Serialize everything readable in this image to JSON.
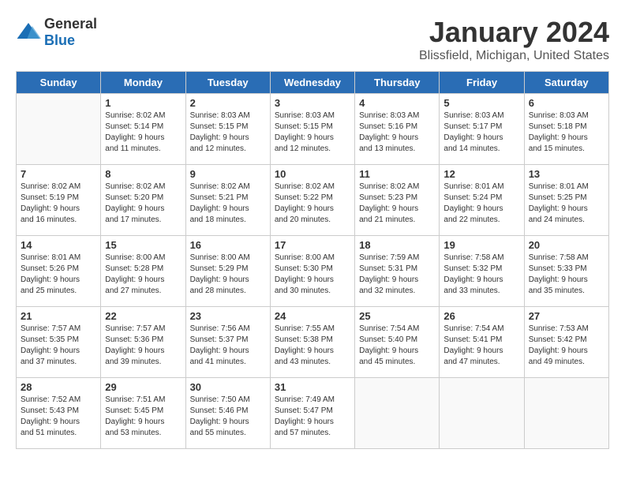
{
  "header": {
    "logo_general": "General",
    "logo_blue": "Blue",
    "month_year": "January 2024",
    "location": "Blissfield, Michigan, United States"
  },
  "weekdays": [
    "Sunday",
    "Monday",
    "Tuesday",
    "Wednesday",
    "Thursday",
    "Friday",
    "Saturday"
  ],
  "weeks": [
    [
      {
        "day": "",
        "info": ""
      },
      {
        "day": "1",
        "info": "Sunrise: 8:02 AM\nSunset: 5:14 PM\nDaylight: 9 hours\nand 11 minutes."
      },
      {
        "day": "2",
        "info": "Sunrise: 8:03 AM\nSunset: 5:15 PM\nDaylight: 9 hours\nand 12 minutes."
      },
      {
        "day": "3",
        "info": "Sunrise: 8:03 AM\nSunset: 5:15 PM\nDaylight: 9 hours\nand 12 minutes."
      },
      {
        "day": "4",
        "info": "Sunrise: 8:03 AM\nSunset: 5:16 PM\nDaylight: 9 hours\nand 13 minutes."
      },
      {
        "day": "5",
        "info": "Sunrise: 8:03 AM\nSunset: 5:17 PM\nDaylight: 9 hours\nand 14 minutes."
      },
      {
        "day": "6",
        "info": "Sunrise: 8:03 AM\nSunset: 5:18 PM\nDaylight: 9 hours\nand 15 minutes."
      }
    ],
    [
      {
        "day": "7",
        "info": "Sunrise: 8:02 AM\nSunset: 5:19 PM\nDaylight: 9 hours\nand 16 minutes."
      },
      {
        "day": "8",
        "info": "Sunrise: 8:02 AM\nSunset: 5:20 PM\nDaylight: 9 hours\nand 17 minutes."
      },
      {
        "day": "9",
        "info": "Sunrise: 8:02 AM\nSunset: 5:21 PM\nDaylight: 9 hours\nand 18 minutes."
      },
      {
        "day": "10",
        "info": "Sunrise: 8:02 AM\nSunset: 5:22 PM\nDaylight: 9 hours\nand 20 minutes."
      },
      {
        "day": "11",
        "info": "Sunrise: 8:02 AM\nSunset: 5:23 PM\nDaylight: 9 hours\nand 21 minutes."
      },
      {
        "day": "12",
        "info": "Sunrise: 8:01 AM\nSunset: 5:24 PM\nDaylight: 9 hours\nand 22 minutes."
      },
      {
        "day": "13",
        "info": "Sunrise: 8:01 AM\nSunset: 5:25 PM\nDaylight: 9 hours\nand 24 minutes."
      }
    ],
    [
      {
        "day": "14",
        "info": "Sunrise: 8:01 AM\nSunset: 5:26 PM\nDaylight: 9 hours\nand 25 minutes."
      },
      {
        "day": "15",
        "info": "Sunrise: 8:00 AM\nSunset: 5:28 PM\nDaylight: 9 hours\nand 27 minutes."
      },
      {
        "day": "16",
        "info": "Sunrise: 8:00 AM\nSunset: 5:29 PM\nDaylight: 9 hours\nand 28 minutes."
      },
      {
        "day": "17",
        "info": "Sunrise: 8:00 AM\nSunset: 5:30 PM\nDaylight: 9 hours\nand 30 minutes."
      },
      {
        "day": "18",
        "info": "Sunrise: 7:59 AM\nSunset: 5:31 PM\nDaylight: 9 hours\nand 32 minutes."
      },
      {
        "day": "19",
        "info": "Sunrise: 7:58 AM\nSunset: 5:32 PM\nDaylight: 9 hours\nand 33 minutes."
      },
      {
        "day": "20",
        "info": "Sunrise: 7:58 AM\nSunset: 5:33 PM\nDaylight: 9 hours\nand 35 minutes."
      }
    ],
    [
      {
        "day": "21",
        "info": "Sunrise: 7:57 AM\nSunset: 5:35 PM\nDaylight: 9 hours\nand 37 minutes."
      },
      {
        "day": "22",
        "info": "Sunrise: 7:57 AM\nSunset: 5:36 PM\nDaylight: 9 hours\nand 39 minutes."
      },
      {
        "day": "23",
        "info": "Sunrise: 7:56 AM\nSunset: 5:37 PM\nDaylight: 9 hours\nand 41 minutes."
      },
      {
        "day": "24",
        "info": "Sunrise: 7:55 AM\nSunset: 5:38 PM\nDaylight: 9 hours\nand 43 minutes."
      },
      {
        "day": "25",
        "info": "Sunrise: 7:54 AM\nSunset: 5:40 PM\nDaylight: 9 hours\nand 45 minutes."
      },
      {
        "day": "26",
        "info": "Sunrise: 7:54 AM\nSunset: 5:41 PM\nDaylight: 9 hours\nand 47 minutes."
      },
      {
        "day": "27",
        "info": "Sunrise: 7:53 AM\nSunset: 5:42 PM\nDaylight: 9 hours\nand 49 minutes."
      }
    ],
    [
      {
        "day": "28",
        "info": "Sunrise: 7:52 AM\nSunset: 5:43 PM\nDaylight: 9 hours\nand 51 minutes."
      },
      {
        "day": "29",
        "info": "Sunrise: 7:51 AM\nSunset: 5:45 PM\nDaylight: 9 hours\nand 53 minutes."
      },
      {
        "day": "30",
        "info": "Sunrise: 7:50 AM\nSunset: 5:46 PM\nDaylight: 9 hours\nand 55 minutes."
      },
      {
        "day": "31",
        "info": "Sunrise: 7:49 AM\nSunset: 5:47 PM\nDaylight: 9 hours\nand 57 minutes."
      },
      {
        "day": "",
        "info": ""
      },
      {
        "day": "",
        "info": ""
      },
      {
        "day": "",
        "info": ""
      }
    ]
  ]
}
